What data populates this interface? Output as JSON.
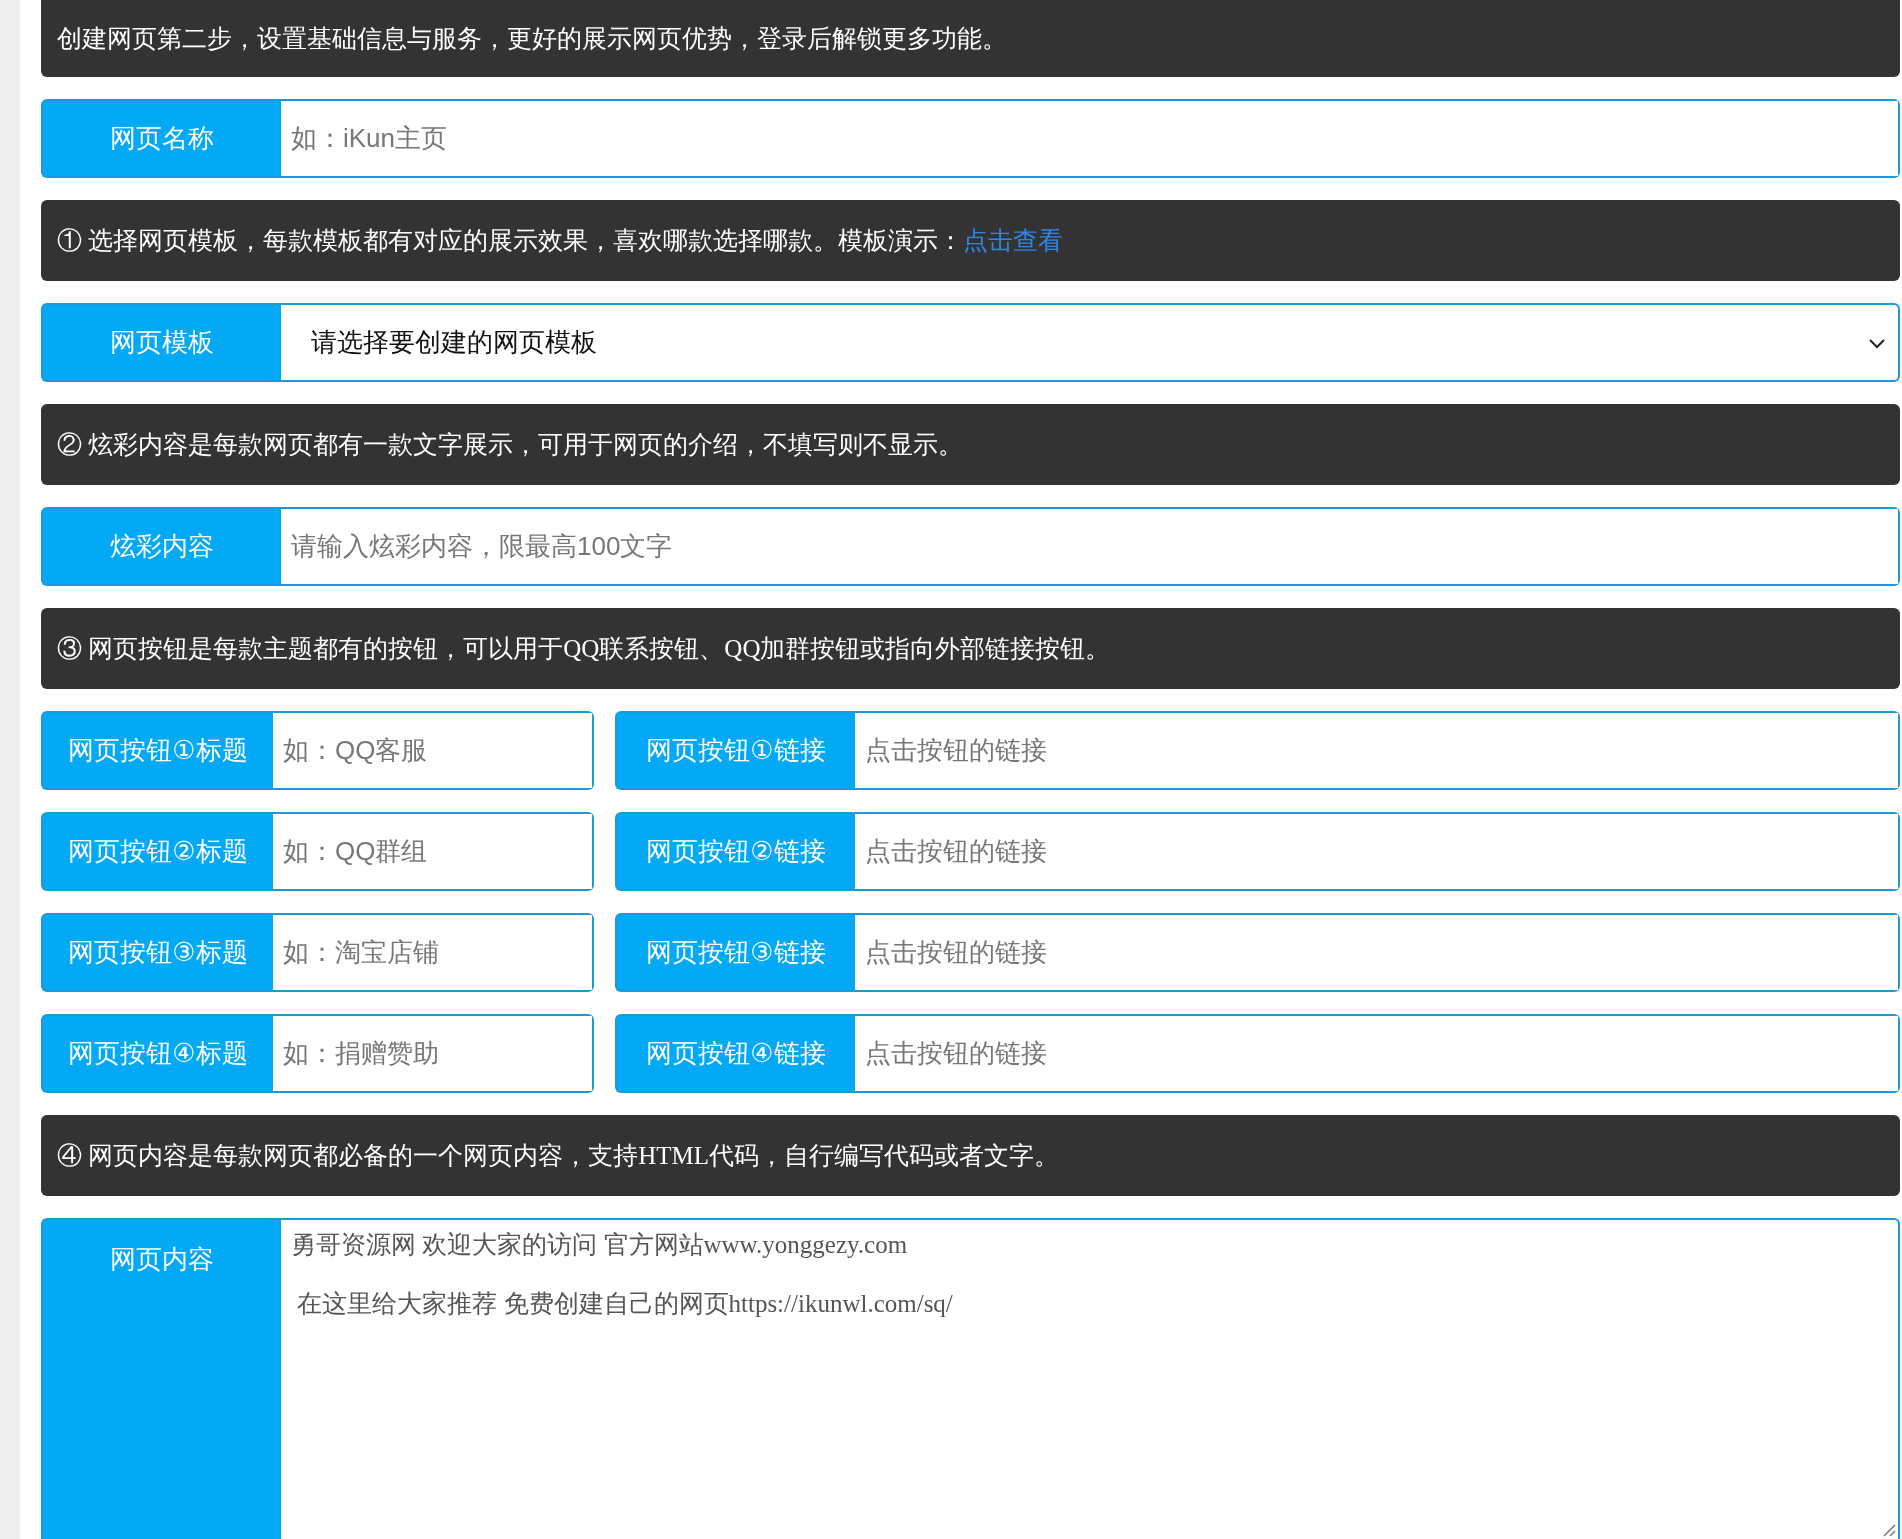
{
  "blocks": [
    {
      "kind": "notice",
      "text": "创建网页第二步，设置基础信息与服务，更好的展示网页优势，登录后解锁更多功能。"
    },
    {
      "kind": "input",
      "label": "网页名称",
      "placeholder": "如：iKun主页"
    },
    {
      "kind": "notice",
      "text": "① 选择网页模板，每款模板都有对应的展示效果，喜欢哪款选择哪款。模板演示：",
      "link": "点击查看"
    },
    {
      "kind": "select",
      "label": "网页模板",
      "value": "请选择要创建的网页模板"
    },
    {
      "kind": "notice",
      "text": "② 炫彩内容是每款网页都有一款文字展示，可用于网页的介绍，不填写则不显示。"
    },
    {
      "kind": "input",
      "label": "炫彩内容",
      "placeholder": "请输入炫彩内容，限最高100文字"
    },
    {
      "kind": "notice",
      "text": "③ 网页按钮是每款主题都有的按钮，可以用于QQ联系按钮、QQ加群按钮或指向外部链接按钮。"
    },
    {
      "kind": "pair",
      "left": {
        "label": "网页按钮①标题",
        "placeholder": "如：QQ客服"
      },
      "right": {
        "label": "网页按钮①链接",
        "placeholder": "点击按钮的链接"
      }
    },
    {
      "kind": "pair",
      "left": {
        "label": "网页按钮②标题",
        "placeholder": "如：QQ群组"
      },
      "right": {
        "label": "网页按钮②链接",
        "placeholder": "点击按钮的链接"
      }
    },
    {
      "kind": "pair",
      "left": {
        "label": "网页按钮③标题",
        "placeholder": "如：淘宝店铺"
      },
      "right": {
        "label": "网页按钮③链接",
        "placeholder": "点击按钮的链接"
      }
    },
    {
      "kind": "pair",
      "left": {
        "label": "网页按钮④标题",
        "placeholder": "如：捐赠赞助"
      },
      "right": {
        "label": "网页按钮④链接",
        "placeholder": "点击按钮的链接"
      }
    },
    {
      "kind": "notice",
      "text": "④ 网页内容是每款网页都必备的一个网页内容，支持HTML代码，自行编写代码或者文字。"
    },
    {
      "kind": "textarea",
      "label": "网页内容",
      "lines": [
        "勇哥资源网 欢迎大家的访问 官方网站www.yonggezy.com",
        " 在这里给大家推荐 免费创建自己的网页https://ikunwl.com/sq/"
      ]
    }
  ]
}
